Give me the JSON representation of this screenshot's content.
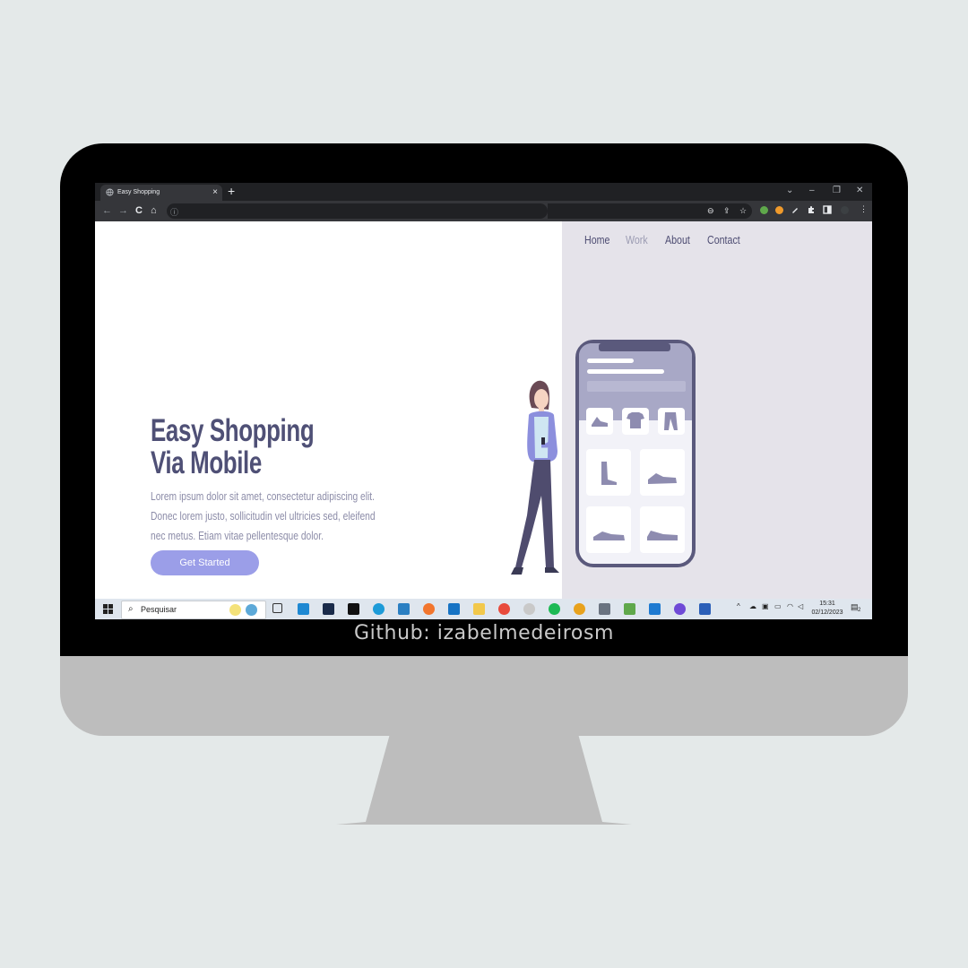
{
  "browser": {
    "tab_title": "Easy Shopping",
    "tab_close": "×",
    "new_tab": "+",
    "window_controls": [
      "⌄",
      "–",
      "❐",
      "✕"
    ],
    "nav": {
      "back": "←",
      "forward": "→",
      "reload": "C",
      "home": "⌂",
      "info": "ⓘ"
    },
    "toolbar_icons": [
      "⊖",
      "⇪",
      "☆"
    ]
  },
  "page": {
    "nav_links": [
      "Home",
      "Work",
      "About",
      "Contact"
    ],
    "hero_title_line1": "Easy Shopping",
    "hero_title_line2": "Via Mobile",
    "hero_text": "Lorem ipsum dolor sit amet, consectetur adipiscing elit. Donec lorem justo, sollicitudin vel ultricies sed, eleifend nec metus. Etiam vitae pellentesque dolor.",
    "cta_label": "Get Started",
    "colors": {
      "accent": "#9b9ee8",
      "heading": "#4f5076",
      "panel": "#e5e3ea",
      "phone": "#5a597c"
    }
  },
  "taskbar": {
    "search_placeholder": "Pesquisar",
    "time": "15:31",
    "date": "02/12/2023",
    "notification_count": "2"
  },
  "caption": "Github: izabelmedeirosm"
}
